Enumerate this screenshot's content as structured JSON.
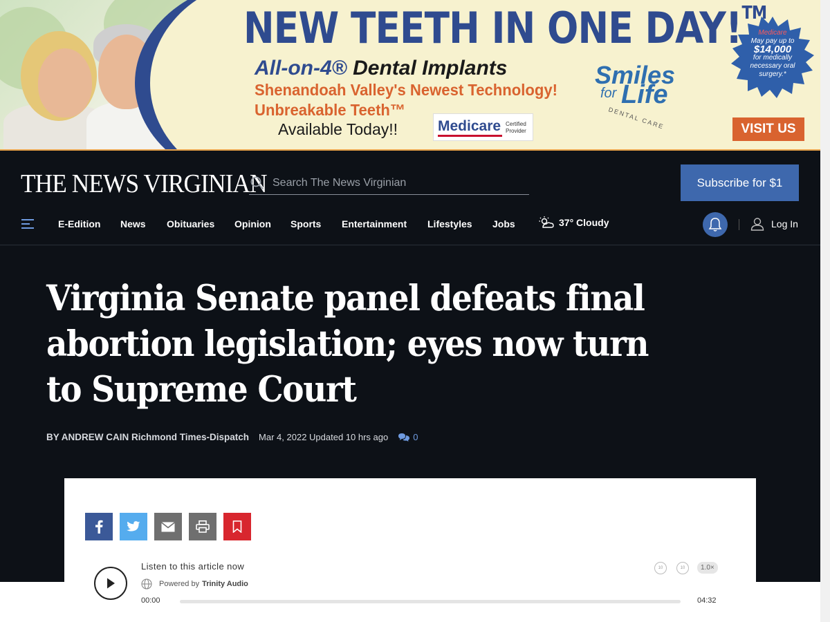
{
  "ad": {
    "headline": "NEW TEETH IN ONE DAY!",
    "headline_tm": "TM",
    "line1_blue": "All-on-4®",
    "line1_black": " Dental Implants",
    "line2": "Shenandoah Valley's Newest Technology!",
    "line3": "Unbreakable Teeth™",
    "line4": "Available Today!!",
    "medicare": "Medicare",
    "medicare_cert": "Certified Provider",
    "brand_1": "Smiles",
    "brand_2": "for",
    "brand_3": "Life",
    "brand_4": "DENTAL CARE",
    "star_top": "Medicare",
    "star_mid": "May pay up to",
    "star_amount": "$14,000",
    "star_bottom": "for medically necessary oral surgery.*",
    "cta": "VISIT US"
  },
  "header": {
    "logo": "THE NEWS VIRGINIAN",
    "search_placeholder": "Search The News Virginian",
    "subscribe": "Subscribe for $1",
    "nav": [
      "E-Edition",
      "News",
      "Obituaries",
      "Opinion",
      "Sports",
      "Entertainment",
      "Lifestyles",
      "Jobs"
    ],
    "weather": "37° Cloudy",
    "login": "Log In"
  },
  "article": {
    "headline": "Virginia Senate panel defeats final abortion legislation; eyes now turn to Supreme Court",
    "byline": "BY ANDREW CAIN Richmond Times-Dispatch",
    "date": "Mar 4, 2022 Updated 10 hrs ago",
    "comments": "0"
  },
  "player": {
    "listen_label": "Listen to this article now",
    "powered_prefix": "Powered by",
    "powered_brand": "Trinity Audio",
    "time_current": "00:00",
    "time_total": "04:32",
    "speed": "1.0×",
    "rewind": "10",
    "forward": "10",
    "progress": 0
  },
  "share": {
    "icons": [
      "facebook-icon",
      "twitter-icon",
      "email-icon",
      "print-icon",
      "bookmark-icon"
    ]
  },
  "colors": {
    "header_bg": "#0d1117",
    "accent_blue": "#3e68ad",
    "ad_orange": "#d9632f",
    "ad_blue": "#2f4b8f"
  }
}
